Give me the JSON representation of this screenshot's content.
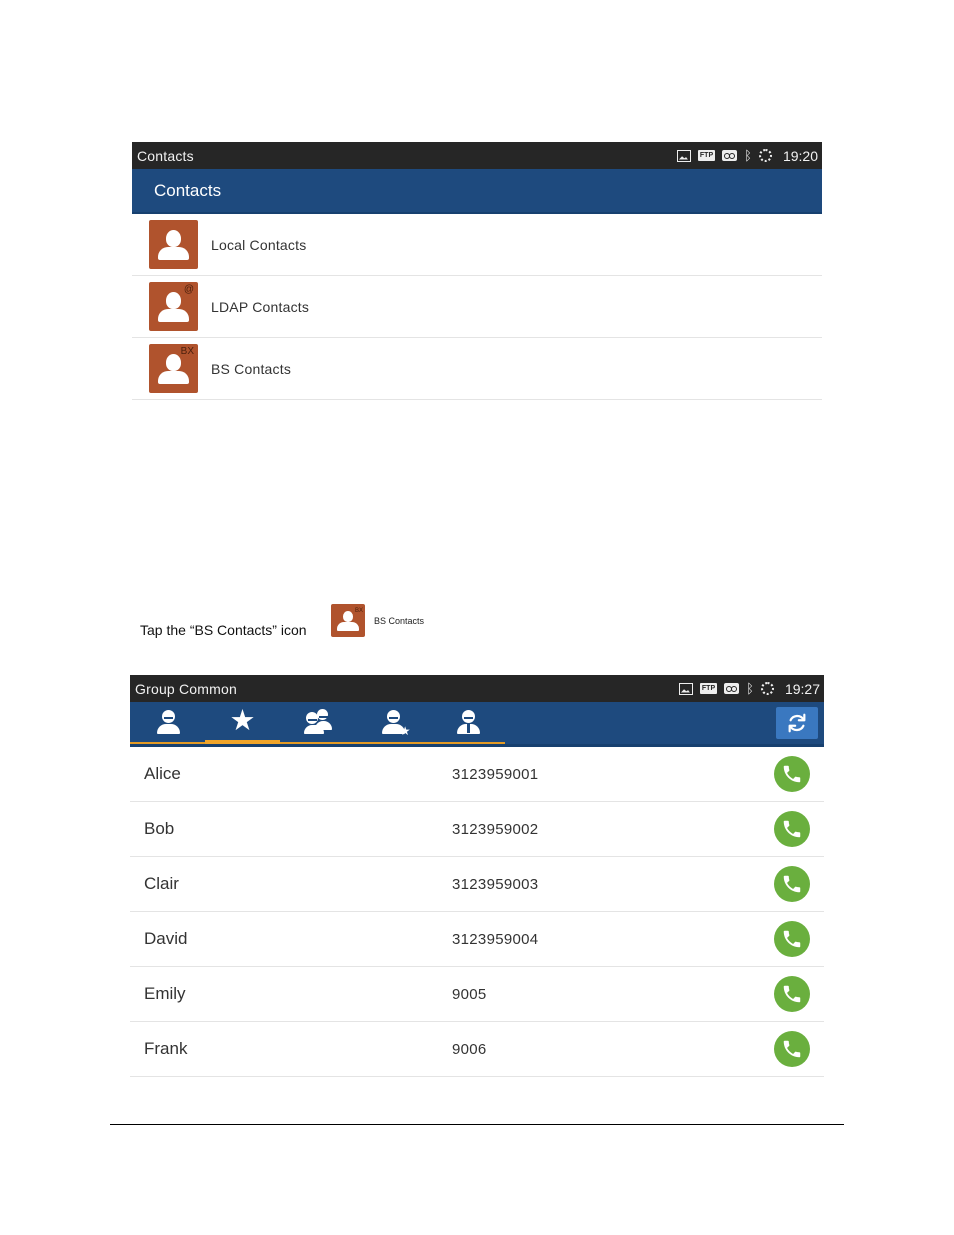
{
  "screen1": {
    "status": {
      "app_title": "Contacts",
      "time": "19:20",
      "ftp_label": "FTP"
    },
    "action_title": "Contacts",
    "items": [
      {
        "label": "Local Contacts",
        "badge": ""
      },
      {
        "label": "LDAP Contacts",
        "badge": "@"
      },
      {
        "label": "BS Contacts",
        "badge": "BX"
      }
    ]
  },
  "caption": {
    "text": "Tap the “BS Contacts” icon",
    "icon_label": "BS Contacts",
    "icon_badge": "BX"
  },
  "screen2": {
    "status": {
      "app_title": "Group Common",
      "time": "19:27",
      "ftp_label": "FTP"
    },
    "tabs": [
      {
        "name": "all-contacts",
        "selected": false
      },
      {
        "name": "favorites",
        "selected": true
      },
      {
        "name": "group-common",
        "selected": false
      },
      {
        "name": "group-favorites",
        "selected": false
      },
      {
        "name": "enterprise",
        "selected": false
      }
    ],
    "contacts": [
      {
        "name": "Alice",
        "number": "3123959001"
      },
      {
        "name": "Bob",
        "number": "3123959002"
      },
      {
        "name": "Clair",
        "number": "3123959003"
      },
      {
        "name": "David",
        "number": "3123959004"
      },
      {
        "name": "Emily",
        "number": "9005"
      },
      {
        "name": "Frank",
        "number": "9006"
      }
    ]
  },
  "colors": {
    "action_bar": "#1e4a7e",
    "status_bar": "#262626",
    "avatar": "#b0532d",
    "tab_underline": "#f0a52b",
    "call_button": "#6aaf3e",
    "refresh_button": "#3a78c0"
  }
}
